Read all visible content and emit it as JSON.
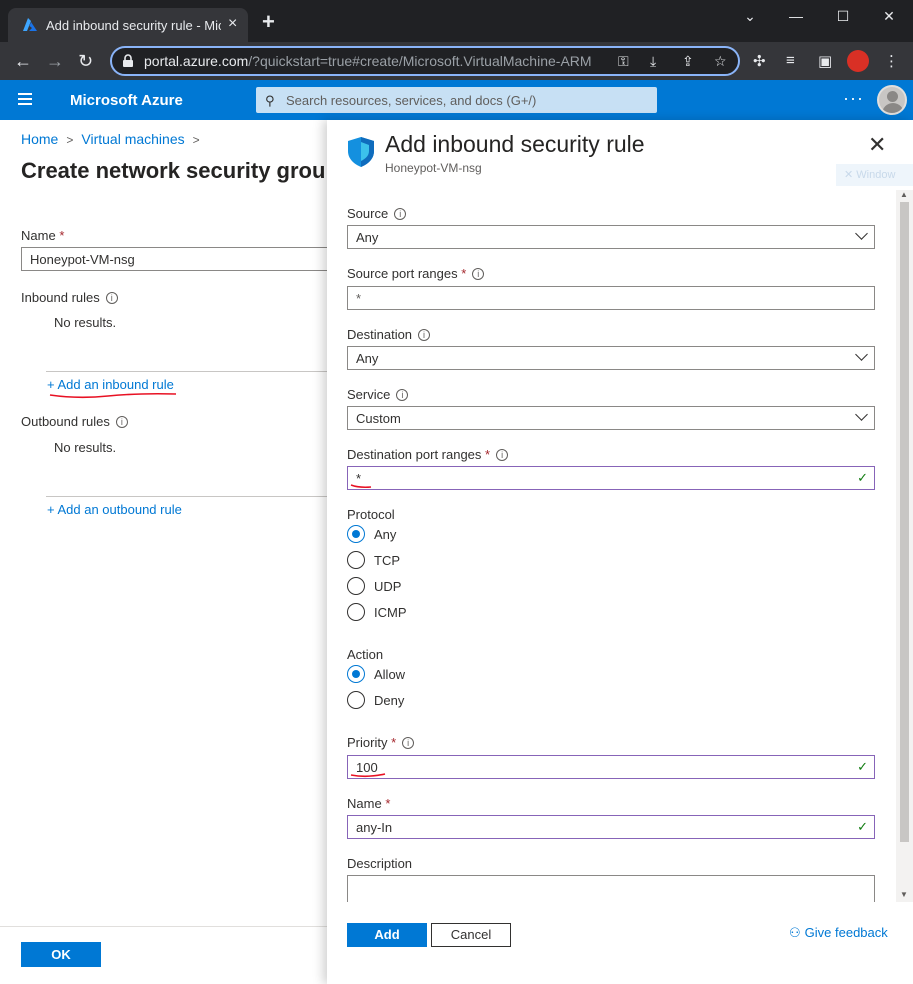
{
  "browser": {
    "tab_title": "Add inbound security rule - Micr",
    "url_host": "portal.azure.com",
    "url_path": "/?quickstart=true#create/Microsoft.VirtualMachine-ARM"
  },
  "header": {
    "brand": "Microsoft Azure",
    "search_placeholder": "Search resources, services, and docs (G+/)"
  },
  "left": {
    "breadcrumb": [
      "Home",
      "Virtual machines"
    ],
    "page_title": "Create network security grou",
    "name_label": "Name",
    "name_value": "Honeypot-VM-nsg",
    "inbound_label": "Inbound rules",
    "inbound_empty": "No results.",
    "add_inbound": "+ Add an inbound rule",
    "outbound_label": "Outbound rules",
    "outbound_empty": "No results.",
    "add_outbound": "+ Add an outbound rule",
    "ok_label": "OK"
  },
  "panel": {
    "title": "Add inbound security rule",
    "subtitle": "Honeypot-VM-nsg",
    "ghost_chip": "Window",
    "fields": {
      "source_label": "Source",
      "source_value": "Any",
      "source_port_label": "Source port ranges",
      "source_port_placeholder": "*",
      "destination_label": "Destination",
      "destination_value": "Any",
      "service_label": "Service",
      "service_value": "Custom",
      "dest_port_label": "Destination port ranges",
      "dest_port_value": "*",
      "protocol_label": "Protocol",
      "protocol_options": [
        "Any",
        "TCP",
        "UDP",
        "ICMP"
      ],
      "protocol_selected": "Any",
      "action_label": "Action",
      "action_options": [
        "Allow",
        "Deny"
      ],
      "action_selected": "Allow",
      "priority_label": "Priority",
      "priority_value": "100",
      "name_label": "Name",
      "name_value": "any-In",
      "description_label": "Description"
    },
    "add_label": "Add",
    "cancel_label": "Cancel",
    "feedback_label": "Give feedback"
  },
  "colors": {
    "azure_blue": "#0078d4",
    "valid_border": "#8764b8",
    "check_green": "#107c10",
    "required_red": "#a4262c",
    "annotation_red": "#e81123"
  }
}
